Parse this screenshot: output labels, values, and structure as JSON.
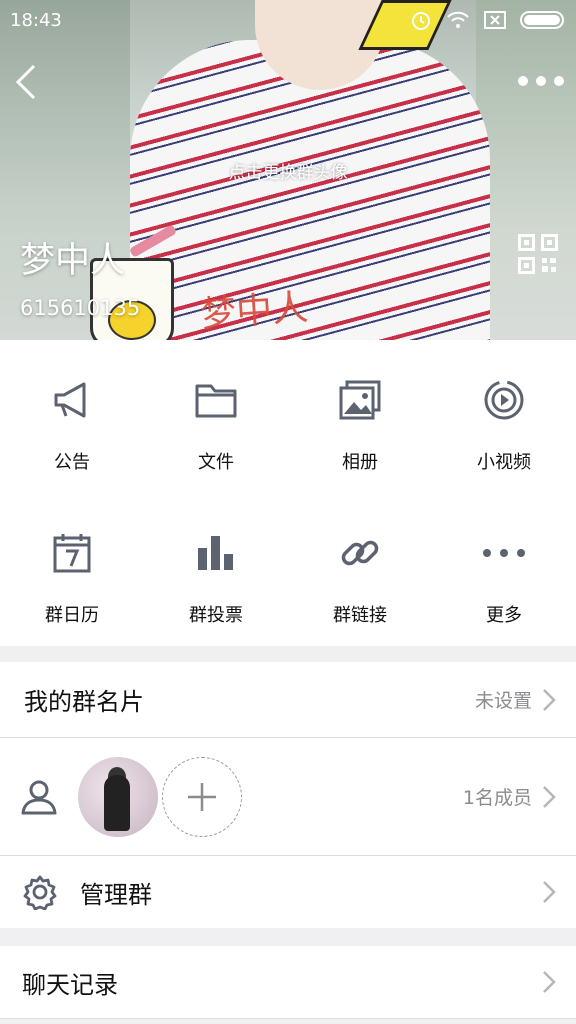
{
  "status_bar": {
    "time": "18:43"
  },
  "header": {
    "change_avatar_hint": "点击更换群头像",
    "group_name": "梦中人",
    "group_id": "615610135",
    "photo_caption": "梦中人"
  },
  "grid": [
    {
      "label": "公告",
      "icon": "megaphone-icon"
    },
    {
      "label": "文件",
      "icon": "folder-icon"
    },
    {
      "label": "相册",
      "icon": "photo-album-icon"
    },
    {
      "label": "小视频",
      "icon": "video-play-icon"
    },
    {
      "label": "群日历",
      "icon": "calendar-icon"
    },
    {
      "label": "群投票",
      "icon": "bar-chart-icon"
    },
    {
      "label": "群链接",
      "icon": "link-icon"
    },
    {
      "label": "更多",
      "icon": "more-dots-icon"
    }
  ],
  "my_card": {
    "label": "我的群名片",
    "value": "未设置"
  },
  "members": {
    "count_text": "1名成员"
  },
  "manage": {
    "label": "管理群"
  },
  "chat_history": {
    "label": "聊天记录"
  },
  "colors": {
    "icon_gray": "#5d6270",
    "text_gray": "#8b8b90",
    "divider": "#dedee2",
    "background": "#f0f0f3"
  }
}
